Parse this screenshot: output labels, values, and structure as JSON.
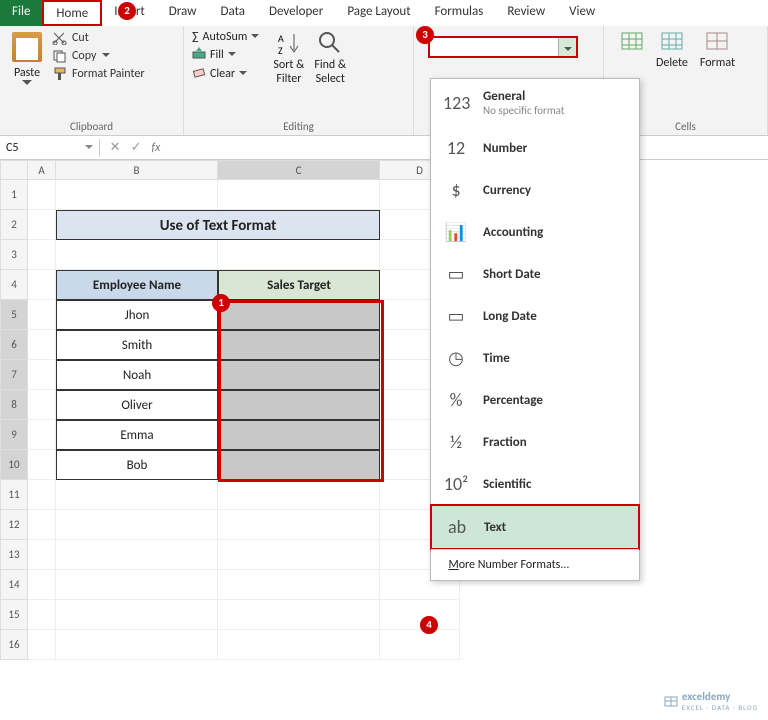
{
  "tabs": {
    "file": "File",
    "home": "Home",
    "insert": "Insert",
    "draw": "Draw",
    "data": "Data",
    "developer": "Developer",
    "page_layout": "Page Layout",
    "formulas": "Formulas",
    "review": "Review",
    "view": "View"
  },
  "clipboard": {
    "paste": "Paste",
    "cut": "Cut",
    "copy": "Copy",
    "fmt": "Format Painter",
    "label": "Clipboard"
  },
  "editing": {
    "autosum": "AutoSum",
    "fill": "Fill",
    "clear": "Clear",
    "sort": "Sort &\nFilter",
    "find": "Find &\nSelect",
    "label": "Editing"
  },
  "cells": {
    "delete": "Delete",
    "format": "Format",
    "label": "Cells"
  },
  "namebox": "C5",
  "colhdrs": [
    "A",
    "B",
    "C",
    "D"
  ],
  "rows": [
    "1",
    "2",
    "3",
    "4",
    "5",
    "6",
    "7",
    "8",
    "9",
    "10",
    "11",
    "12",
    "13",
    "14",
    "15",
    "16"
  ],
  "table": {
    "title": "Use of Text Format",
    "h1": "Employee Name",
    "h2": "Sales Target",
    "names": [
      "Jhon",
      "Smith",
      "Noah",
      "Oliver",
      "Emma",
      "Bob"
    ]
  },
  "formats": [
    {
      "icon_top": "⏲",
      "icon": "123",
      "label": "General",
      "sub": "No specific format"
    },
    {
      "icon": "12",
      "label": "Number"
    },
    {
      "icon": "$",
      "label": "Currency"
    },
    {
      "icon": "📊",
      "label": "Accounting"
    },
    {
      "icon": "▭",
      "label": "Short Date"
    },
    {
      "icon": "▭",
      "label": "Long Date"
    },
    {
      "icon": "◷",
      "label": "Time"
    },
    {
      "icon": "%",
      "label": "Percentage"
    },
    {
      "icon": "½",
      "label": "Fraction"
    },
    {
      "icon": "10²",
      "label": "Scientific"
    },
    {
      "icon": "ab",
      "label": "Text",
      "selected": true
    }
  ],
  "more_formats": "More Number Formats...",
  "watermark": "exceldemy",
  "watermark_sub": "EXCEL · DATA · BLOG",
  "callouts": {
    "1": "1",
    "2": "2",
    "3": "3",
    "4": "4"
  }
}
